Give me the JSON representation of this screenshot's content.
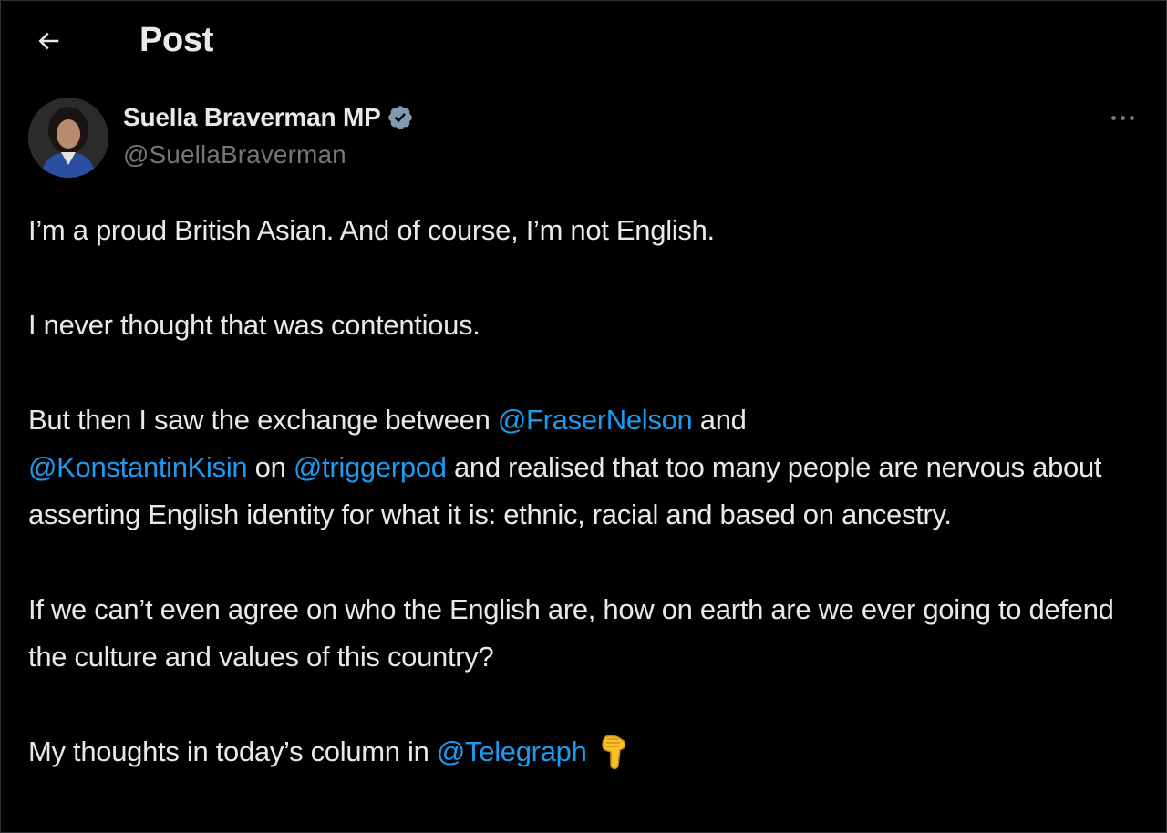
{
  "header": {
    "title": "Post",
    "back_icon": "arrow-left-icon"
  },
  "author": {
    "name": "Suella Braverman MP",
    "handle": "@SuellaBraverman",
    "verified_icon": "verified-badge-icon",
    "verified_color": "#829aab",
    "more_icon": "more-horizontal-icon"
  },
  "post": {
    "p1": "I’m a proud British Asian. And of course, I’m not English.",
    "p2": "I never thought that was contentious.",
    "p3": {
      "t1": "But then I saw the exchange between ",
      "m1": "@FraserNelson",
      "t2": " and ",
      "m2": "@KonstantinKisin",
      "t3": " on ",
      "m3": "@triggerpod",
      "t4": " and realised that too many people are nervous about asserting English identity for what it is: ethnic, racial and based on ancestry."
    },
    "p4": "If we can’t even agree on who the English are, how on earth are we ever going to defend the culture and values of this country?",
    "p5": {
      "t1": "My thoughts in today’s column in ",
      "m1": "@Telegraph",
      "emoji": "backhand-index-pointing-down-icon"
    }
  },
  "colors": {
    "background": "#000000",
    "text": "#e7e9ea",
    "secondary": "#71767b",
    "link": "#1d9bf0"
  }
}
